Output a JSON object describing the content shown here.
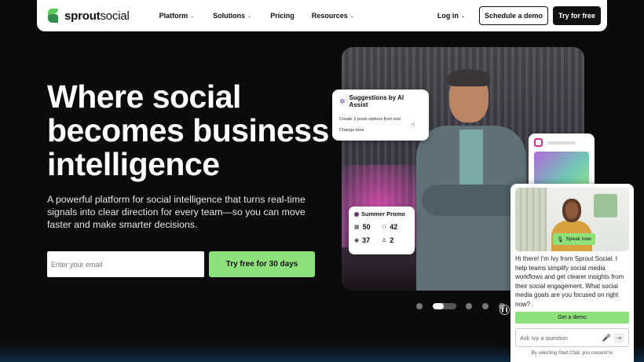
{
  "nav": {
    "brand_bold": "sprout",
    "brand_light": "social",
    "items": [
      {
        "label": "Platform",
        "chevron": true
      },
      {
        "label": "Solutions",
        "chevron": true
      },
      {
        "label": "Pricing",
        "chevron": false
      },
      {
        "label": "Resources",
        "chevron": true
      }
    ],
    "login_label": "Log in",
    "demo_label": "Schedule a demo",
    "try_label": "Try for free"
  },
  "hero": {
    "headline": "Where social becomes business intelligence",
    "subtext": "A powerful platform for social intelligence that turns real-time signals into clear direction for every team—so you can move faster and make smarter decisions.",
    "email_placeholder": "Enter your email",
    "cta_label": "Try free for 30 days"
  },
  "ai_card": {
    "title": "Suggestions by AI Assist",
    "line1": "Create 3 posts options from text",
    "line2": "Change tone"
  },
  "promo_card": {
    "title": "Summer Promo",
    "stats": [
      {
        "icon": "calendar-icon",
        "value": "50"
      },
      {
        "icon": "users-icon",
        "value": "42"
      },
      {
        "icon": "eye-icon",
        "value": "37"
      },
      {
        "icon": "person-icon",
        "value": "2"
      }
    ]
  },
  "carousel": {
    "slide_count": 5,
    "active_index": 1,
    "active_progress": 0.45
  },
  "chat": {
    "speak_label": "Speak now",
    "message": "Hi there! I'm Ivy from Sprout Social. I help teams simplify social media workflows and get clearer insights from their social engagement. What social media goals are you focused on right now?",
    "demo_label": "Get a demo",
    "ask_placeholder": "Ask Ivy a question",
    "consent": "By selecting Start Chat, you consent to"
  },
  "colors": {
    "accent_green": "#8ee07a",
    "brand_green": "#59cb59",
    "background": "#0b0b0b",
    "ai_purple": "#7b3fb5",
    "promo_purple": "#6b2f7a"
  }
}
